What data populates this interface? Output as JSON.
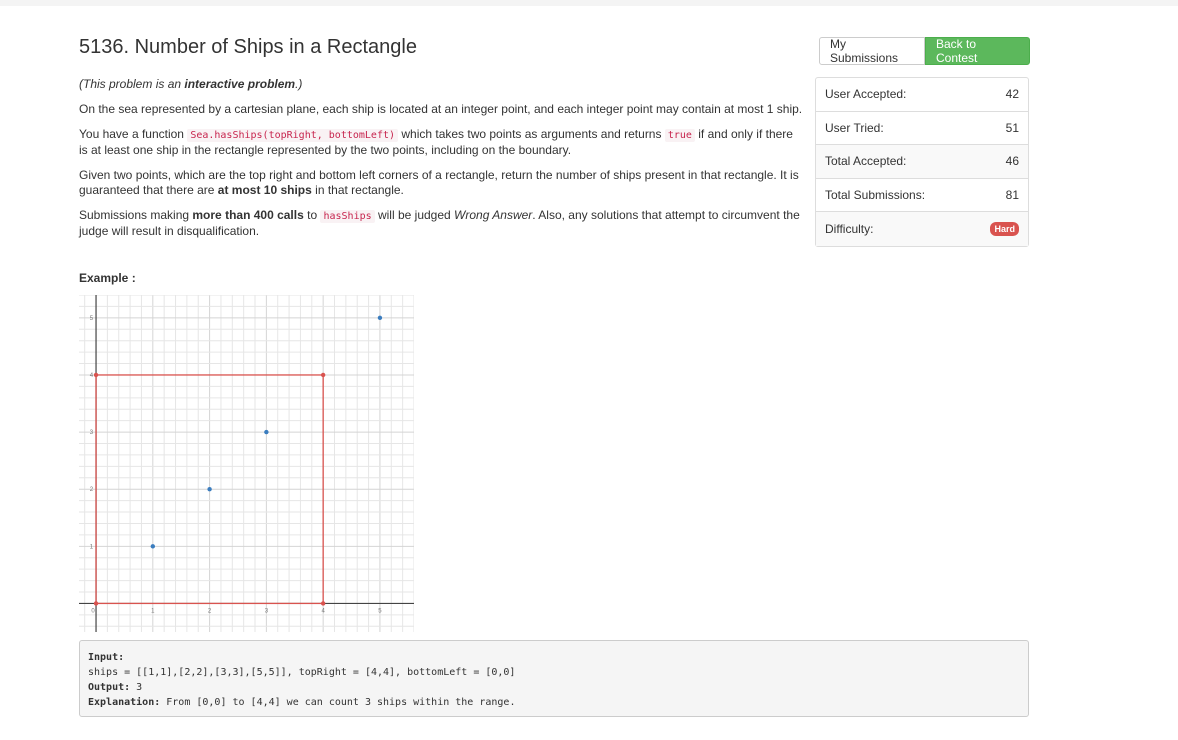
{
  "problem": {
    "title": "5136. Number of Ships in a Rectangle",
    "p1_pre": "(This problem is an ",
    "p1_bold": "interactive problem",
    "p1_post": ".)",
    "p2": "On the sea represented by a cartesian plane, each ship is located at an integer point, and each integer point may contain at most 1 ship.",
    "p3_a": "You have a function ",
    "p3_code1": "Sea.hasShips(topRight, bottomLeft)",
    "p3_b": " which takes two points as arguments and returns ",
    "p3_code2": "true",
    "p3_c": " if and only if there is at least one ship in the rectangle represented by the two points, including on the boundary.",
    "p4_a": "Given two points, which are the top right and bottom left corners of a rectangle, return the number of ships present in that rectangle.  It is guaranteed that there are ",
    "p4_bold": "at most 10 ships",
    "p4_b": " in that rectangle.",
    "p5_a": "Submissions making ",
    "p5_bold": "more than 400 calls",
    "p5_b": " to ",
    "p5_code": "hasShips",
    "p5_c": " will be judged ",
    "p5_ital": "Wrong Answer",
    "p5_d": ".  Also, any solutions that attempt to circumvent the judge will result in disqualification.",
    "example_label": "Example :"
  },
  "example": {
    "input_label": "Input:",
    "input_value": "ships = [[1,1],[2,2],[3,3],[5,5]], topRight = [4,4], bottomLeft = [0,0]",
    "output_label": "Output:",
    "output_value": " 3",
    "explanation_label": "Explanation:",
    "explanation_value": " From [0,0] to [4,4] we can count 3 ships within the range."
  },
  "actions": {
    "my_submissions": "My Submissions",
    "back_to_contest": "Back to Contest"
  },
  "stats": {
    "user_accepted_label": "User Accepted:",
    "user_accepted": "42",
    "user_tried_label": "User Tried:",
    "user_tried": "51",
    "total_accepted_label": "Total Accepted:",
    "total_accepted": "46",
    "total_submissions_label": "Total Submissions:",
    "total_submissions": "81",
    "difficulty_label": "Difficulty:",
    "difficulty": "Hard"
  },
  "chart_data": {
    "type": "scatter",
    "x_ticks": [
      "0",
      "1",
      "2",
      "3",
      "4",
      "5"
    ],
    "y_ticks": [
      "1",
      "2",
      "3",
      "4",
      "5"
    ],
    "xlim": [
      -0.3,
      5.6
    ],
    "ylim": [
      -0.5,
      5.4
    ],
    "ships": [
      [
        1,
        1
      ],
      [
        2,
        2
      ],
      [
        3,
        3
      ],
      [
        5,
        5
      ]
    ],
    "rectangle": {
      "bottomLeft": [
        0,
        0
      ],
      "topRight": [
        4,
        4
      ]
    },
    "colors": {
      "ship": "#3b7dbf",
      "rect": "#d9534f",
      "grid": "#e6e6e6",
      "axis": "#444444"
    }
  }
}
